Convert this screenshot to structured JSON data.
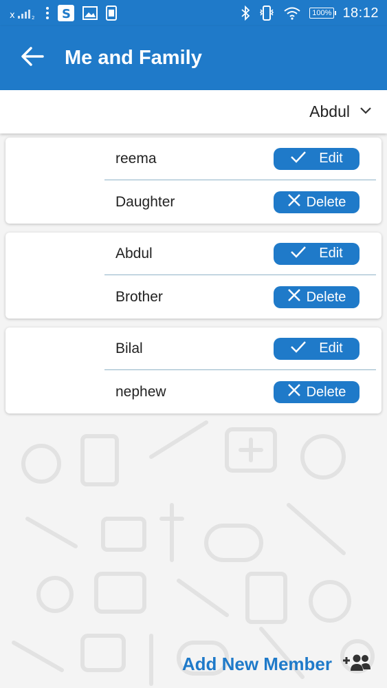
{
  "status_bar": {
    "time": "18:12",
    "battery": "100%",
    "signal_label": "x",
    "icons": [
      "signal-icon",
      "menu-dots-icon",
      "app-s-icon",
      "image-icon",
      "sim-icon",
      "bluetooth-icon",
      "vibrate-icon",
      "wifi-icon",
      "battery-icon"
    ]
  },
  "app_bar": {
    "title": "Me and Family",
    "back_icon": "arrow-left-icon"
  },
  "selector": {
    "value": "Abdul",
    "icon": "chevron-down-icon"
  },
  "members": [
    {
      "name": "reema",
      "relation": "Daughter",
      "edit_label": "Edit",
      "delete_label": "Delete"
    },
    {
      "name": "Abdul",
      "relation": "Brother",
      "edit_label": "Edit",
      "delete_label": "Delete"
    },
    {
      "name": "Bilal",
      "relation": "nephew",
      "edit_label": "Edit",
      "delete_label": "Delete"
    }
  ],
  "add_member": {
    "label": "Add New Member",
    "icon": "add-group-icon"
  },
  "colors": {
    "primary": "#1f7ac9",
    "background": "#f4f4f4",
    "card": "#ffffff",
    "divider": "#8fb3c7"
  }
}
